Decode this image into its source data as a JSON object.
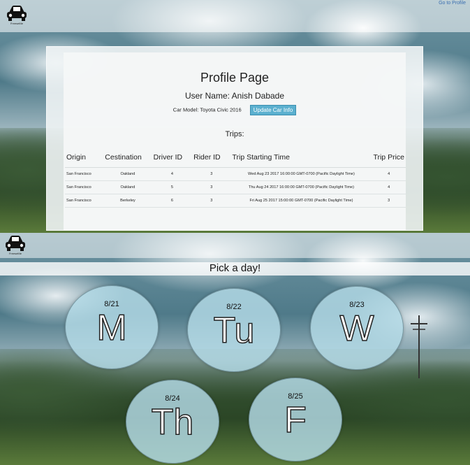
{
  "header": {
    "go_to_profile": "Go to Profile",
    "logo_text": "FreeseMe"
  },
  "profile": {
    "title": "Profile Page",
    "user_name": "User Name: Anish Dabade",
    "car_model": "Car Model: Toyota Civic 2016",
    "update_button": "Update Car Info",
    "trips_label": "Trips:"
  },
  "trips_table": {
    "headers": [
      "Origin",
      "Cestination",
      "Driver ID",
      "Rider ID",
      "Trip Starting Time",
      "Trip Price"
    ],
    "rows": [
      [
        "San Francisco",
        "Oakland",
        "4",
        "3",
        "Wed Aug 23 2017 16:00:00 GMT-0700 (Pacific Daylight Time)",
        "4"
      ],
      [
        "San Francisco",
        "Oakland",
        "5",
        "3",
        "Thu Aug 24 2017 16:00:00 GMT-0700 (Pacific Daylight Time)",
        "4"
      ],
      [
        "San Francisco",
        "Berkeley",
        "6",
        "3",
        "Fri Aug 25 2017 15:00:00 GMT-0700 (Pacific Daylight Time)",
        "3"
      ]
    ]
  },
  "day_picker": {
    "title": "Pick a day!",
    "days": [
      {
        "date": "8/21",
        "abbr": "M"
      },
      {
        "date": "8/22",
        "abbr": "Tu"
      },
      {
        "date": "8/23",
        "abbr": "W"
      },
      {
        "date": "8/24",
        "abbr": "Th"
      },
      {
        "date": "8/25",
        "abbr": "F"
      }
    ]
  },
  "icons": {
    "logo": "car-icon"
  }
}
